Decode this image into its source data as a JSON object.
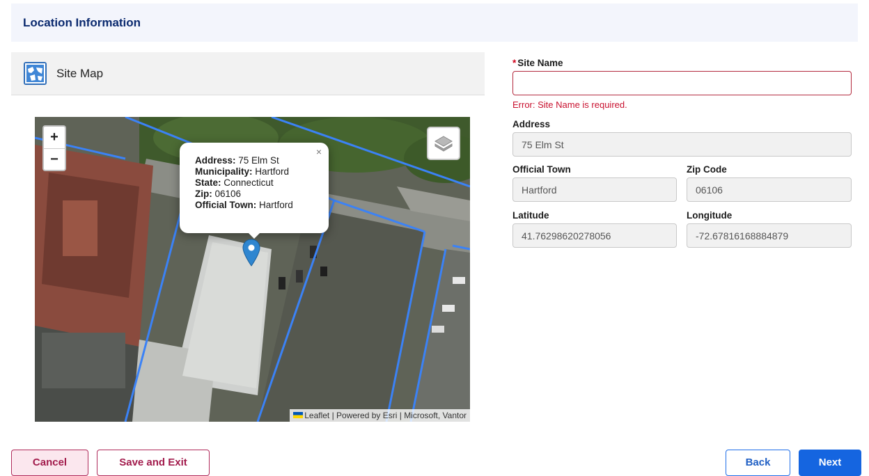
{
  "section": {
    "title": "Location Information"
  },
  "map_panel": {
    "label": "Site Map",
    "icon": "map-icon"
  },
  "map": {
    "zoom_in": "+",
    "zoom_out": "−",
    "layers_icon": "layers-icon",
    "popup": {
      "close": "×",
      "address_label": "Address:",
      "address_value": "75 Elm St",
      "municipality_label": "Municipality:",
      "municipality_value": "Hartford",
      "state_label": "State:",
      "state_value": "Connecticut",
      "zip_label": "Zip:",
      "zip_value": "06106",
      "official_town_label": "Official Town:",
      "official_town_value": "Hartford"
    },
    "attribution": "Leaflet | Powered by Esri | Microsoft, Vantor"
  },
  "form": {
    "site_name": {
      "required_mark": "*",
      "label": "Site Name",
      "value": "",
      "error": "Error: Site Name is required."
    },
    "address": {
      "label": "Address",
      "value": "75 Elm St"
    },
    "official_town": {
      "label": "Official Town",
      "value": "Hartford"
    },
    "zip_code": {
      "label": "Zip Code",
      "value": "06106"
    },
    "latitude": {
      "label": "Latitude",
      "value": "41.76298620278056"
    },
    "longitude": {
      "label": "Longitude",
      "value": "-72.67816168884879"
    }
  },
  "buttons": {
    "cancel": "Cancel",
    "save_exit": "Save and Exit",
    "back": "Back",
    "next": "Next"
  },
  "colors": {
    "header_text": "#0b2a6f",
    "error": "#c8102e",
    "primary": "#1565e0",
    "secondary": "#a21b4c"
  }
}
